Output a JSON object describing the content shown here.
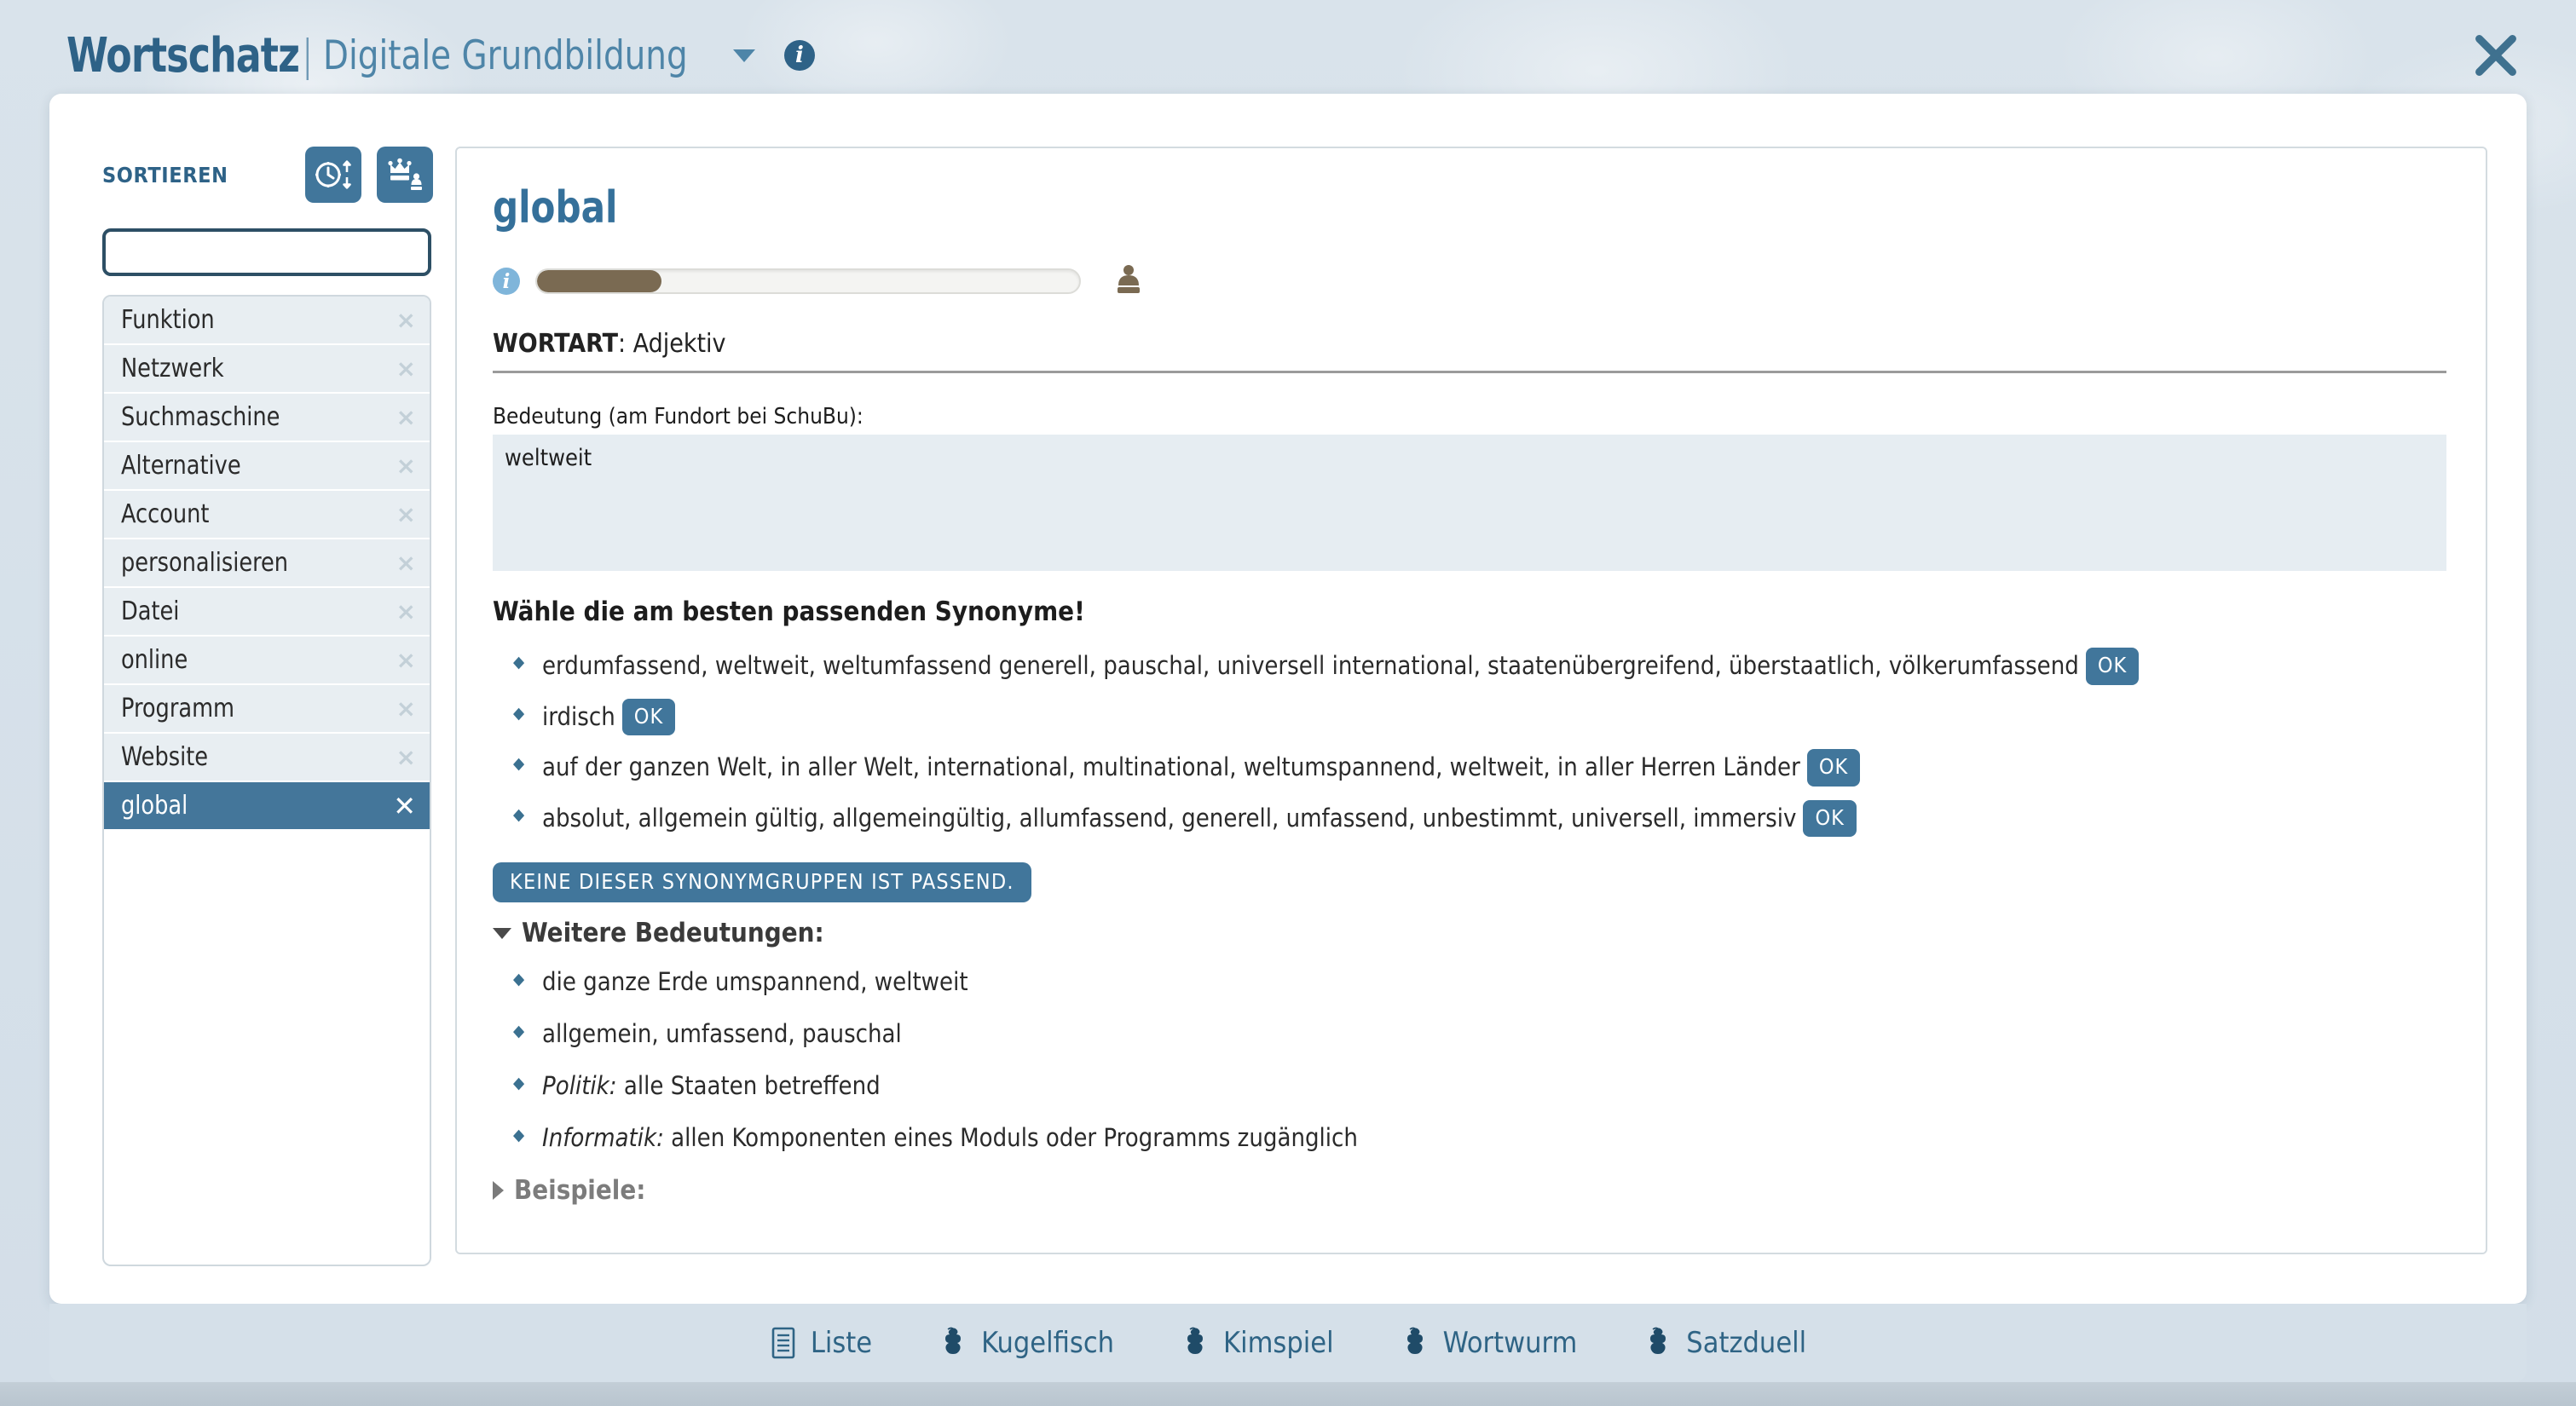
{
  "titlebar": {
    "brand": "Wortschatz",
    "separator": "|",
    "subtitle": "Digitale Grundbildung",
    "info_label": "i",
    "close_label": "✕"
  },
  "sidebar": {
    "sort_label": "SORTIEREN",
    "sort_buttons": [
      {
        "name": "sort-by-time-button",
        "icon": "clock-arrows-icon"
      },
      {
        "name": "sort-by-rank-button",
        "icon": "crown-pawn-icon"
      }
    ],
    "search_value": "",
    "search_placeholder": "",
    "words": [
      {
        "label": "Funktion",
        "selected": false,
        "remove": "×"
      },
      {
        "label": "Netzwerk",
        "selected": false,
        "remove": "×"
      },
      {
        "label": "Suchmaschine",
        "selected": false,
        "remove": "×"
      },
      {
        "label": "Alternative",
        "selected": false,
        "remove": "×"
      },
      {
        "label": "Account",
        "selected": false,
        "remove": "×"
      },
      {
        "label": "personalisieren",
        "selected": false,
        "remove": "×"
      },
      {
        "label": "Datei",
        "selected": false,
        "remove": "×"
      },
      {
        "label": "online",
        "selected": false,
        "remove": "×"
      },
      {
        "label": "Programm",
        "selected": false,
        "remove": "×"
      },
      {
        "label": "Website",
        "selected": false,
        "remove": "×"
      },
      {
        "label": "global",
        "selected": true,
        "remove": "✕"
      }
    ]
  },
  "detail": {
    "word": "global",
    "info_label": "i",
    "progress_percent": 23,
    "progress_color": "#7a6a52",
    "pawn_icon": "pawn-icon",
    "wortart_label": "WORTART",
    "wortart_value": ": Adjektiv",
    "bedeutung_label": "Bedeutung (am Fundort bei SchuBu):",
    "bedeutung_value": "weltweit",
    "synonyms_heading": "Wähle die am besten passenden Synonyme!",
    "ok_label": "OK",
    "synonym_groups": [
      {
        "text": "erdumfassend, weltweit, weltumfassend generell, pauschal, universell international, staatenübergreifend, überstaatlich, völkerumfassend"
      },
      {
        "text": "irdisch"
      },
      {
        "text": "auf der ganzen Welt, in aller Welt, international, multinational, weltumspannend, weltweit, in aller Herren Länder"
      },
      {
        "text": "absolut, allgemein gültig, allgemeingültig, allumfassend, generell, umfassend, unbestimmt, universell, immersiv"
      }
    ],
    "none_fitting_label": "KEINE DIESER SYNONYMGRUPPEN IST PASSEND.",
    "weitere_heading": "Weitere Bedeutungen:",
    "weitere_items": [
      {
        "domain": "",
        "text": "die ganze Erde umspannend, weltweit"
      },
      {
        "domain": "",
        "text": "allgemein, umfassend, pauschal"
      },
      {
        "domain": "Politik:",
        "text": " alle Staaten betreffend"
      },
      {
        "domain": "Informatik:",
        "text": " allen Komponenten eines Moduls oder Programms zugänglich"
      }
    ],
    "beispiele_heading": "Beispiele:"
  },
  "footer": {
    "items": [
      {
        "label": "Liste",
        "icon": "list-icon"
      },
      {
        "label": "Kugelfisch",
        "icon": "puzzle-icon"
      },
      {
        "label": "Kimspiel",
        "icon": "puzzle-icon"
      },
      {
        "label": "Wortwurm",
        "icon": "puzzle-icon"
      },
      {
        "label": "Satzduell",
        "icon": "puzzle-icon"
      }
    ]
  },
  "colors": {
    "accent": "#41769b",
    "brand": "#2e6287",
    "backdrop": "#d6e1ea",
    "selected_row": "#44769a"
  }
}
